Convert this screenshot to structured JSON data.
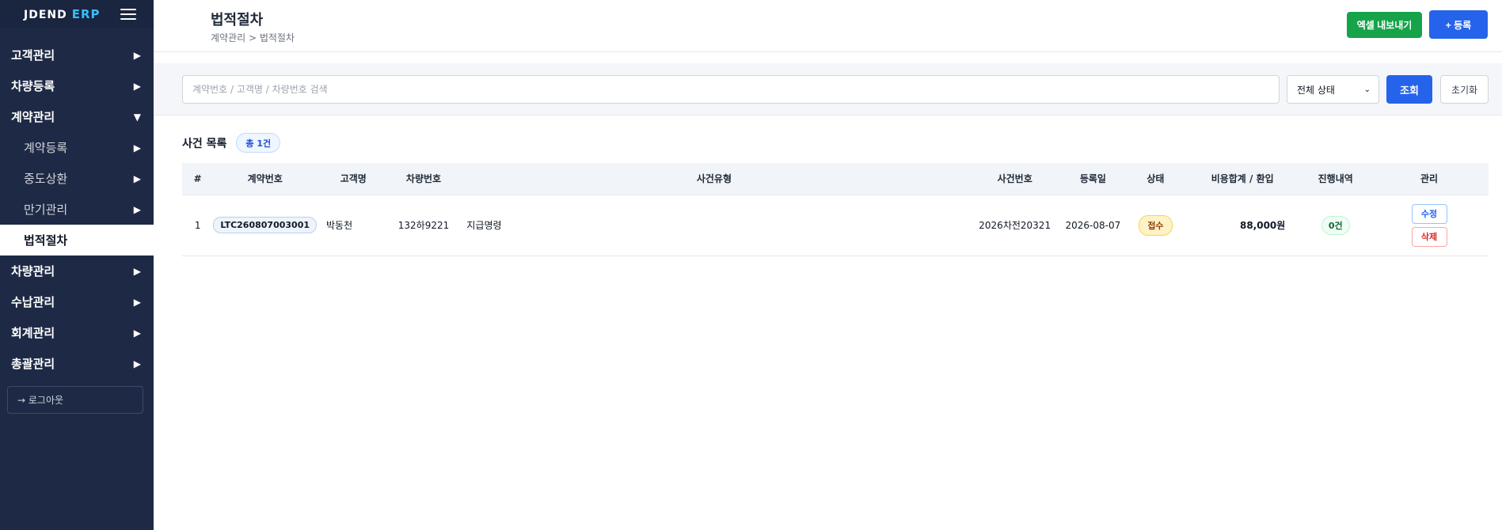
{
  "sidebar": {
    "brand": "JDEND",
    "brand_accent": "ERP",
    "items": [
      {
        "label": "고객관리",
        "arrow": "▶"
      },
      {
        "label": "차량등록",
        "arrow": "▶"
      },
      {
        "label": "계약관리",
        "arrow": "▼"
      },
      {
        "label": "계약등록",
        "arrow": "▶"
      },
      {
        "label": "중도상환",
        "arrow": "▶"
      },
      {
        "label": "만기관리",
        "arrow": "▶"
      },
      {
        "label": "법적절차",
        "arrow": ""
      },
      {
        "label": "차량관리",
        "arrow": "▶"
      },
      {
        "label": "수납관리",
        "arrow": "▶"
      },
      {
        "label": "회계관리",
        "arrow": "▶"
      },
      {
        "label": "총괄관리",
        "arrow": "▶"
      }
    ],
    "logout": "→ 로그아웃"
  },
  "header": {
    "title": "법적절차",
    "breadcrumb": "계약관리 > 법적절차",
    "excel_label": "엑셀 내보내기",
    "register_label": "+ 등록"
  },
  "search": {
    "placeholder": "계약번호 / 고객명 / 차량번호 검색",
    "value": "",
    "status_selected": "전체 상태",
    "search_label": "조회",
    "reset_label": "초기화"
  },
  "list": {
    "title": "사건 목록",
    "count": "총 1건",
    "columns": [
      "#",
      "계약번호",
      "고객명",
      "차량번호",
      "사건유형",
      "사건번호",
      "등록일",
      "상태",
      "비용합계 / 환입",
      "진행내역",
      "관리"
    ],
    "rows": [
      {
        "no": "1",
        "contract": "LTC260807003001",
        "customer": "박동천",
        "vehicle": "132하9221",
        "case_type": "지급명령",
        "case_no": "2026차전20321",
        "date": "2026-08-07",
        "status": "접수",
        "cost": "88,000원",
        "progress": "0건",
        "edit": "수정",
        "delete": "삭제"
      }
    ]
  },
  "colors": {
    "sidebar_bg": "#1e2a45",
    "accent": "#2563eb",
    "excel": "#16a34a",
    "brand_accent": "#38bdf8"
  }
}
